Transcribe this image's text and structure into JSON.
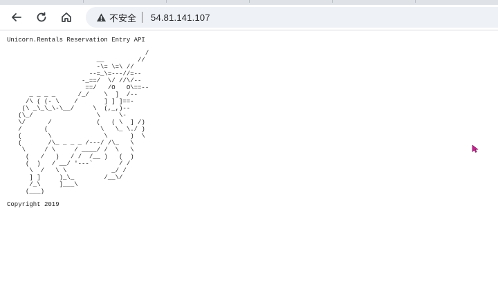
{
  "browser": {
    "tabs": [
      "",
      "",
      "",
      "",
      ""
    ],
    "nav": {
      "back_icon": "arrow-left-icon",
      "reload_icon": "reload-icon",
      "home_icon": "home-icon"
    },
    "omnibox": {
      "security_icon": "warning-triangle-icon",
      "security_label": "不安全",
      "url": "54.81.141.107"
    }
  },
  "page": {
    "heading": "Unicorn.Rentals Reservation Entry API",
    "ascii_art": "                                     /\n                        __         //\n                        -\\= \\=\\ //\n                      --=_\\=---//=--\n                    -_==/  \\/ //\\/--\n                     ==/   /O   O\\==--\n      _ _ _ _      /_/    \\  ]  /--\n     /\\ ( (- \\    /       ] ] ]==-\n    (\\ _\\_\\_\\-\\__/     \\  (,_,)--\n   (\\_/                 \\     \\-\n   \\/      /            (   ( \\  ] /)\n   /      (              \\   \\_ \\./ )\n   (       \\              \\      )  \\\n   (       /\\_ _ _ _ /---/ /\\_   \\\n    \\     / \\     / ____/ /  \\   \\\n     (   /   )   / /  /__ )   (  )\n     (  )   / __/ '---`       / /\n      \\  /   \\ \\            _/ /\n      ] ]     )_\\_        /__\\/\n      /_\\     ]___\\\n     (___)",
    "footer": "Copyright 2019"
  },
  "colors": {
    "tab_strip": "#dfe3e8",
    "omnibox_bg": "#eef1f5",
    "cursor": "#c0248c"
  }
}
